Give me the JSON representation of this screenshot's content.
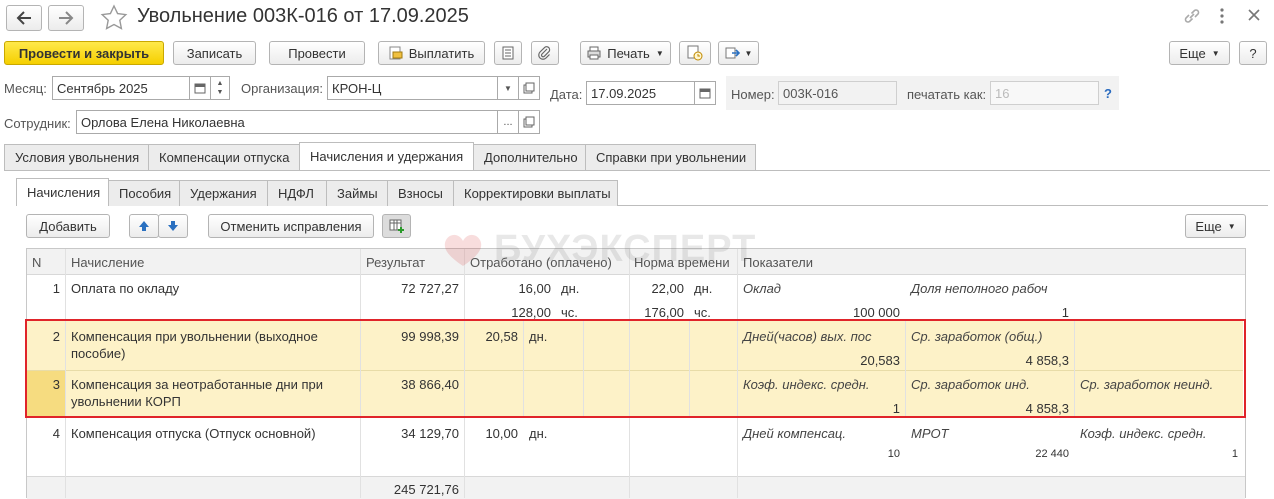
{
  "window": {
    "title": "Увольнение 003К-016 от 17.09.2025"
  },
  "toolbar": {
    "post_close": "Провести и закрыть",
    "save": "Записать",
    "post": "Провести",
    "pay": "Выплатить",
    "print": "Печать",
    "more": "Еще",
    "help": "?"
  },
  "header": {
    "month_label": "Месяц:",
    "month_value": "Сентябрь 2025",
    "org_label": "Организация:",
    "org_value": "КРОН-Ц",
    "date_label": "Дата:",
    "date_value": "17.09.2025",
    "number_label": "Номер:",
    "number_value": "003К-016",
    "print_as_label": "печатать как:",
    "print_as_value": "16",
    "help": "?",
    "employee_label": "Сотрудник:",
    "employee_value": "Орлова Елена Николаевна"
  },
  "tabs": [
    "Условия увольнения",
    "Компенсации отпуска",
    "Начисления и удержания",
    "Дополнительно",
    "Справки при увольнении"
  ],
  "subtabs": [
    "Начисления",
    "Пособия",
    "Удержания",
    "НДФЛ",
    "Займы",
    "Взносы",
    "Корректировки выплаты"
  ],
  "grid_toolbar": {
    "add": "Добавить",
    "cancel_fix": "Отменить исправления",
    "more": "Еще"
  },
  "watermark": "БУХЭКСПЕРТ",
  "table": {
    "headers": {
      "n": "N",
      "accrual": "Начисление",
      "result": "Результат",
      "worked": "Отработано (оплачено)",
      "norm": "Норма времени",
      "indicators": "Показатели"
    },
    "rows": [
      {
        "n": "1",
        "name": [
          "Оплата по окладу",
          ""
        ],
        "result": "72 727,27",
        "worked1": "16,00",
        "unit1": "дн.",
        "worked2": "128,00",
        "unit2": "чс.",
        "norm1": "22,00",
        "nunit1": "дн.",
        "norm2": "176,00",
        "nunit2": "чс.",
        "ind": [
          {
            "label": "Оклад",
            "value": "100 000"
          },
          {
            "label": "Доля неполного рабоч",
            "value": "1"
          },
          {
            "label": "",
            "value": ""
          }
        ]
      },
      {
        "n": "2",
        "name": [
          "Компенсация при увольнении (выходное",
          "пособие)"
        ],
        "result": "99 998,39",
        "worked1": "20,58",
        "unit1": "дн.",
        "worked2": "",
        "unit2": "",
        "norm1": "",
        "nunit1": "",
        "norm2": "",
        "nunit2": "",
        "ind": [
          {
            "label": "Дней(часов) вых. пос",
            "value": "20,583"
          },
          {
            "label": "Ср. заработок (общ.)",
            "value": "4 858,3"
          },
          {
            "label": "",
            "value": ""
          }
        ]
      },
      {
        "n": "3",
        "name": [
          "Компенсация за неотработанные дни при",
          "увольнении КОРП"
        ],
        "result": "38 866,40",
        "worked1": "",
        "unit1": "",
        "worked2": "",
        "unit2": "",
        "norm1": "",
        "nunit1": "",
        "norm2": "",
        "nunit2": "",
        "ind": [
          {
            "label": "Коэф. индекс. средн.",
            "value": "1"
          },
          {
            "label": "Ср. заработок инд.",
            "value": "4 858,3"
          },
          {
            "label": "Ср. заработок неинд.",
            "value": ""
          }
        ]
      },
      {
        "n": "4",
        "name": [
          "Компенсация отпуска (Отпуск основной)",
          ""
        ],
        "result": "34 129,70",
        "worked1": "10,00",
        "unit1": "дн.",
        "worked2": "",
        "unit2": "",
        "norm1": "",
        "nunit1": "",
        "norm2": "",
        "nunit2": "",
        "ind": [
          {
            "label": "Дней компенсац.",
            "value": "10"
          },
          {
            "label": "МРОТ",
            "value": "22 440"
          },
          {
            "label": "Коэф. индекс. средн.",
            "value": "1"
          }
        ]
      }
    ],
    "total": "245 721,76"
  },
  "colors": {
    "accent_yellow": "#f5cf00",
    "highlight": "#fdf2c8",
    "frame": "#e0242a"
  }
}
